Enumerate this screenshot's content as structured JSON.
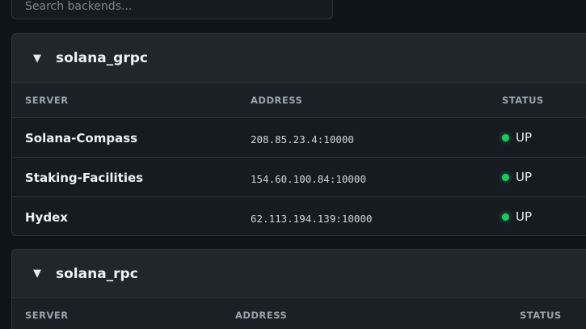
{
  "search": {
    "placeholder": "Search backends..."
  },
  "groups": [
    {
      "name": "solana_grpc",
      "toggle": "▼",
      "columns": [
        "SERVER",
        "ADDRESS",
        "STATUS"
      ],
      "rows": [
        {
          "server": "Solana-Compass",
          "address": "208.85.23.4:10000",
          "status": "UP"
        },
        {
          "server": "Staking-Facilities",
          "address": "154.60.100.84:10000",
          "status": "UP"
        },
        {
          "server": "Hydex",
          "address": "62.113.194.139:10000",
          "status": "UP"
        }
      ]
    },
    {
      "name": "solana_rpc",
      "toggle": "▼",
      "columns": [
        "SERVER",
        "ADDRESS",
        "STATUS"
      ],
      "rows": []
    }
  ],
  "colors": {
    "status_up": "#22c55e",
    "background": "#0f1419",
    "panel": "#161b22",
    "header": "#21262d"
  },
  "icons": {
    "toggle": "collapse-triangle-icon",
    "status": "status-dot-icon"
  }
}
